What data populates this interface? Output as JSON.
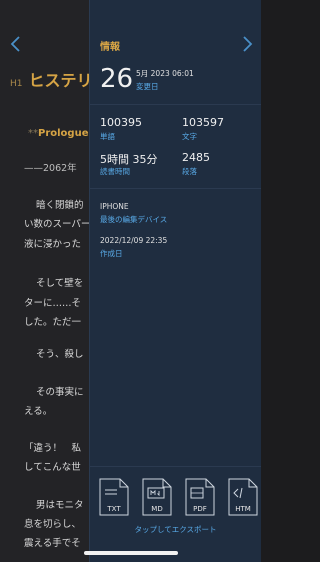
{
  "editor": {
    "heading_tag": "H1",
    "heading": "ヒステリ",
    "prologue_marks_left": "**",
    "prologue": "Prologue",
    "prologue_marks_right": "**",
    "lines": [
      "——2062年",
      "暗く閉鎖的",
      "い数のスーパー",
      "液に浸かった",
      "そして壁を",
      "ターに……そ",
      "した。ただ一",
      "そう、殺し",
      "その事実に",
      "える。",
      "「違う！　私",
      "してこんな世",
      "男はモニタ",
      "息を切らし、",
      "震える手でそ"
    ]
  },
  "panel": {
    "title": "情報",
    "day": "26",
    "date_detail": "5月 2023 06:01",
    "date_label": "変更日",
    "stats": [
      {
        "value": "100395",
        "label": "単語"
      },
      {
        "value": "103597",
        "label": "文字"
      },
      {
        "value": "5時間 35分",
        "label": "読書時間"
      },
      {
        "value": "2485",
        "label": "段落"
      }
    ],
    "device": "IPHONE",
    "device_label": "最後の編集デバイス",
    "created": "2022/12/09 22:35",
    "created_label": "作成日",
    "exports": [
      "TXT",
      "MD",
      "PDF",
      "HTM"
    ],
    "export_hint": "タップしてエクスポート"
  }
}
